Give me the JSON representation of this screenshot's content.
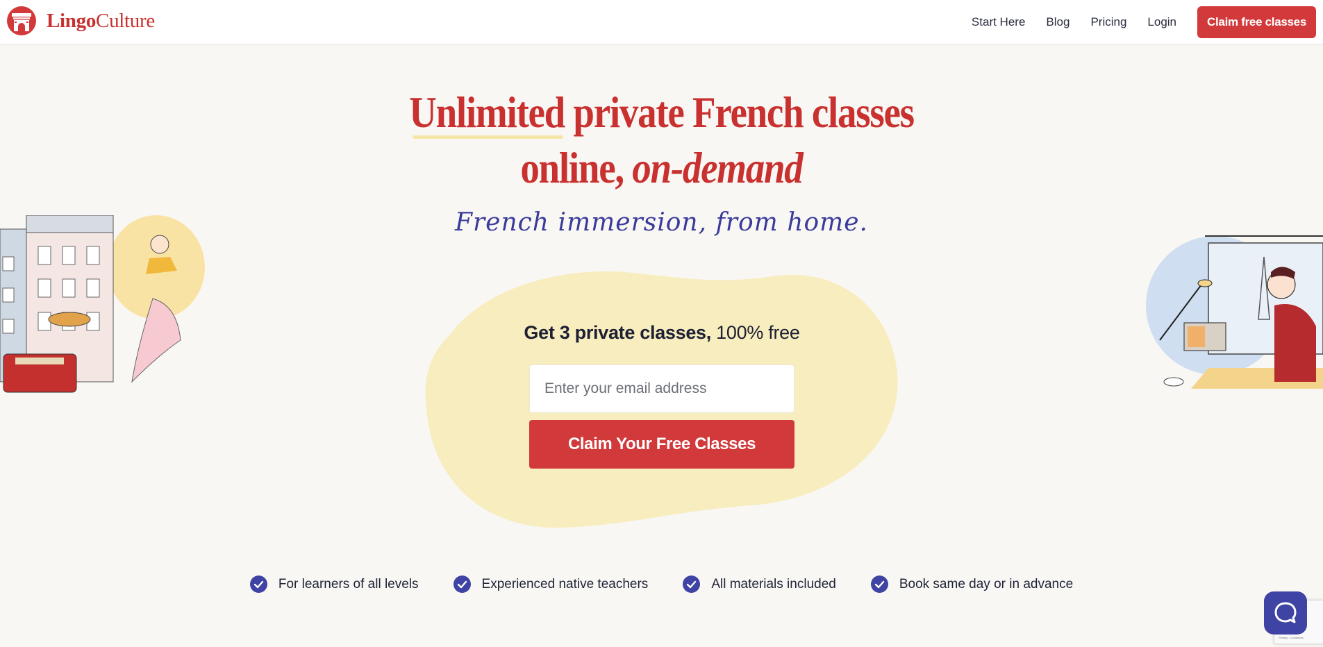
{
  "brand": {
    "name_bold": "Lingo",
    "name_rest": "Culture"
  },
  "nav": {
    "links": [
      "Start Here",
      "Blog",
      "Pricing",
      "Login"
    ],
    "cta": "Claim free classes"
  },
  "hero": {
    "title_word1": "Unlimited",
    "title_rest1": " private French classes",
    "title_line2_a": "online, ",
    "title_line2_b": "on-demand",
    "tagline": "French immersion, from home."
  },
  "offer": {
    "bold": "Get 3 private classes,",
    "rest": " 100% free",
    "email_placeholder": "Enter your email address",
    "email_value": "",
    "button": "Claim Your Free Classes"
  },
  "features": [
    "For learners of all levels",
    "Experienced native teachers",
    "All materials included",
    "Book same day or in advance"
  ],
  "recaptcha": {
    "text": "Privacy - Conditions"
  },
  "colors": {
    "brand_red": "#d2393a",
    "title_red": "#c8312f",
    "indigo": "#3f43a4",
    "blob_yellow": "#f7edbf",
    "background": "#f9f7f4"
  },
  "icons": {
    "logo": "lingoculture-arch-logo",
    "check": "check-circle-icon",
    "chat": "chat-bubble-icon"
  }
}
